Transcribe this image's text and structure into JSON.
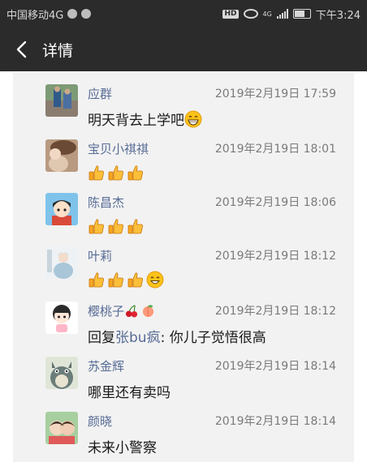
{
  "status_bar": {
    "carrier": "中国移动4G",
    "network": "4G",
    "time": "下午3:24",
    "icons": [
      "wechat-icon",
      "notification-icon",
      "hd-icon",
      "eye-icon",
      "signal-icon",
      "battery-icon"
    ]
  },
  "nav": {
    "back_icon": "chevron-left-icon",
    "title": "详情"
  },
  "comments": [
    {
      "name": "应群",
      "time": "2019年2月19日 17:59",
      "text": "明天背去上学吧",
      "emojis": [
        "grin-emoji"
      ]
    },
    {
      "name": "宝贝小祺祺",
      "time": "2019年2月19日 18:01",
      "text": "",
      "emojis": [
        "thumbs-up-emoji",
        "thumbs-up-emoji",
        "thumbs-up-emoji"
      ]
    },
    {
      "name": "陈昌杰",
      "time": "2019年2月19日 18:06",
      "text": "",
      "emojis": [
        "thumbs-up-emoji",
        "thumbs-up-emoji",
        "thumbs-up-emoji"
      ]
    },
    {
      "name": "叶莉",
      "time": "2019年2月19日 18:12",
      "text": "",
      "emojis": [
        "thumbs-up-emoji",
        "thumbs-up-emoji",
        "thumbs-up-emoji",
        "smile-emoji"
      ]
    },
    {
      "name": "樱桃子",
      "name_emojis": [
        "cherries-emoji",
        "peach-emoji"
      ],
      "time": "2019年2月19日 18:12",
      "text_prefix": "回复",
      "mention": "张bu疯",
      "text": ": 你儿子觉悟很高",
      "emojis": []
    },
    {
      "name": "苏金辉",
      "time": "2019年2月19日 18:14",
      "text": "哪里还有卖吗",
      "emojis": []
    },
    {
      "name": "颜晓",
      "time": "2019年2月19日 18:14",
      "text": "未来小警察",
      "emojis": []
    }
  ]
}
